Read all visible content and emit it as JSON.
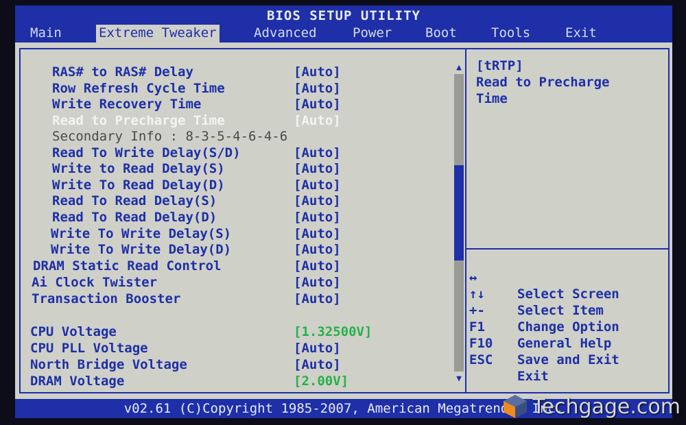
{
  "title": "BIOS SETUP UTILITY",
  "menu": {
    "tabs": [
      {
        "label": "Main"
      },
      {
        "label": "Extreme Tweaker"
      },
      {
        "label": "Advanced"
      },
      {
        "label": "Power"
      },
      {
        "label": "Boot"
      },
      {
        "label": "Tools"
      },
      {
        "label": "Exit"
      }
    ],
    "active_tab": "Extreme Tweaker"
  },
  "settings": [
    {
      "label": "RAS# to RAS# Delay",
      "value": "[Auto]"
    },
    {
      "label": "Row Refresh Cycle Time",
      "value": "[Auto]"
    },
    {
      "label": "Write Recovery Time",
      "value": "[Auto]"
    },
    {
      "label": "Read to Precharge Time",
      "value": "[Auto]",
      "selected": true
    },
    {
      "label": "Secondary Info : 8-3-5-4-6-4-6",
      "value": "",
      "info": true
    },
    {
      "label": "Read To Write Delay(S/D)",
      "value": "[Auto]"
    },
    {
      "label": "Write to Read Delay(S)",
      "value": "[Auto]"
    },
    {
      "label": "Write To Read Delay(D)",
      "value": "[Auto]"
    },
    {
      "label": "Read To Read Delay(S)",
      "value": "[Auto]"
    },
    {
      "label": "Read To Read Delay(D)",
      "value": "[Auto]"
    },
    {
      "label": "Write To Write Delay(S)",
      "value": "[Auto]"
    },
    {
      "label": "Write To Write Delay(D)",
      "value": "[Auto]"
    },
    {
      "label": "DRAM Static Read Control",
      "value": "[Auto]"
    },
    {
      "label": "Ai Clock Twister",
      "value": "[Auto]"
    },
    {
      "label": "Transaction Booster",
      "value": "[Auto]"
    },
    {
      "label": "CPU Voltage",
      "value": "[1.32500V]",
      "highlight": "green"
    },
    {
      "label": "CPU PLL Voltage",
      "value": "[Auto]"
    },
    {
      "label": "North Bridge Voltage",
      "value": "[Auto]"
    },
    {
      "label": "DRAM Voltage",
      "value": "[2.00V]",
      "highlight": "green"
    }
  ],
  "help": {
    "line1": "[tRTP]",
    "line2": "Read to Precharge",
    "line3": "Time"
  },
  "keys": [
    {
      "key": "↔",
      "desc": "Select Screen"
    },
    {
      "key": "↑↓",
      "desc": "Select Item"
    },
    {
      "key": "+-",
      "desc": "Change Option"
    },
    {
      "key": "F1",
      "desc": "General Help"
    },
    {
      "key": "F10",
      "desc": "Save and Exit"
    },
    {
      "key": "ESC",
      "desc": "Exit"
    }
  ],
  "scrollbar": {
    "position_fraction": 0.45,
    "visible_fraction": 0.32
  },
  "footer": "v02.61 (C)Copyright 1985-2007, American Megatrends, Inc.",
  "watermark": "Techgage.com",
  "colors": {
    "bios_blue": "#1e2fa8",
    "panel_gray": "#cfd0c8",
    "value_green": "#24b24a",
    "selected_white": "#f4f4f0"
  }
}
